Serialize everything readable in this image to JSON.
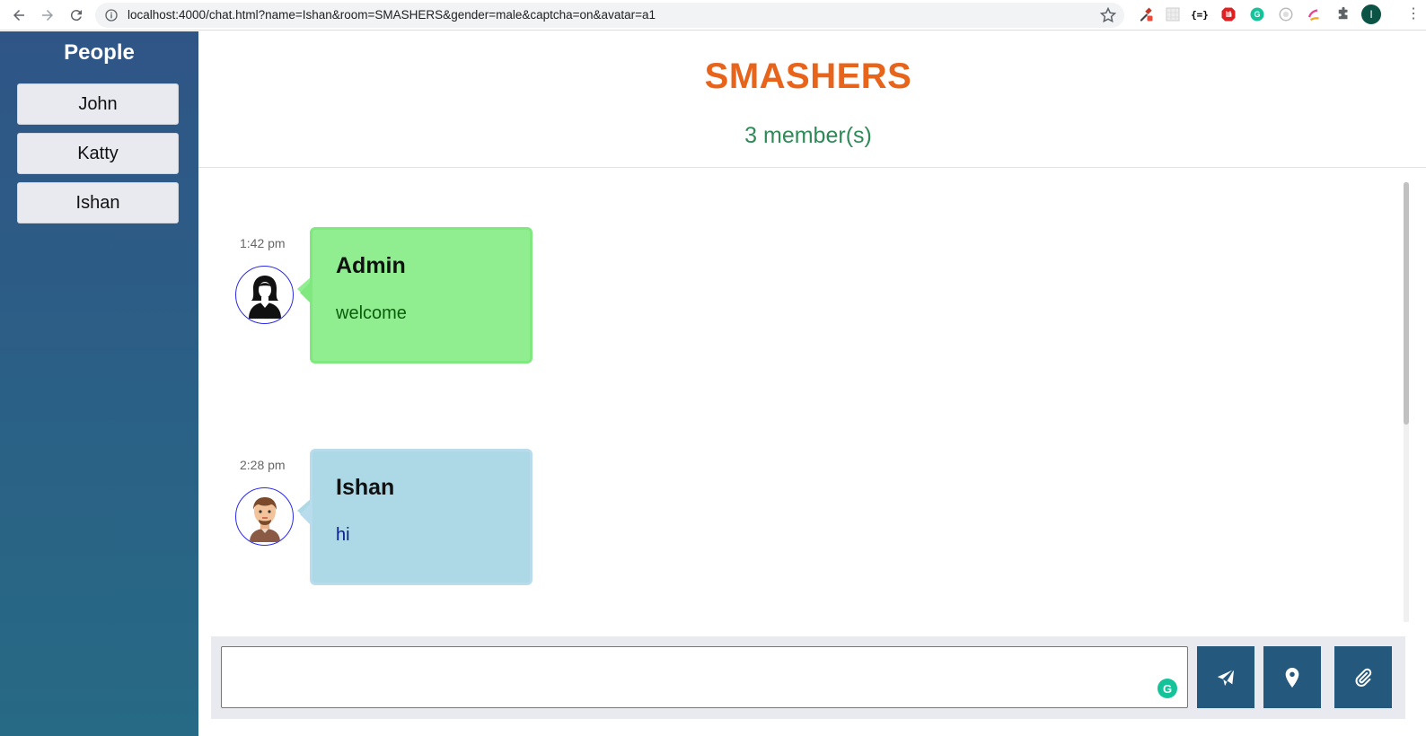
{
  "browser": {
    "url": "localhost:4000/chat.html?name=Ishan&room=SMASHERS&gender=male&captcha=on&avatar=a1",
    "profile_initial": "I"
  },
  "sidebar": {
    "title": "People",
    "people": [
      "John",
      "Katty",
      "Ishan"
    ]
  },
  "header": {
    "room": "SMASHERS",
    "members": "3 member(s)"
  },
  "messages": [
    {
      "time": "1:42 pm",
      "sender": "Admin",
      "text": "welcome",
      "avatar": "female-avatar-icon",
      "color": "#90ee90"
    },
    {
      "time": "2:28 pm",
      "sender": "Ishan",
      "text": "hi",
      "avatar": "male-avatar-icon",
      "color": "#add8e6"
    }
  ],
  "compose": {
    "value": "",
    "actions": [
      "send-icon",
      "location-pin-icon",
      "paperclip-icon"
    ]
  },
  "colors": {
    "accent": "#e8641b",
    "members": "#2e8b57",
    "button": "#25587d"
  }
}
